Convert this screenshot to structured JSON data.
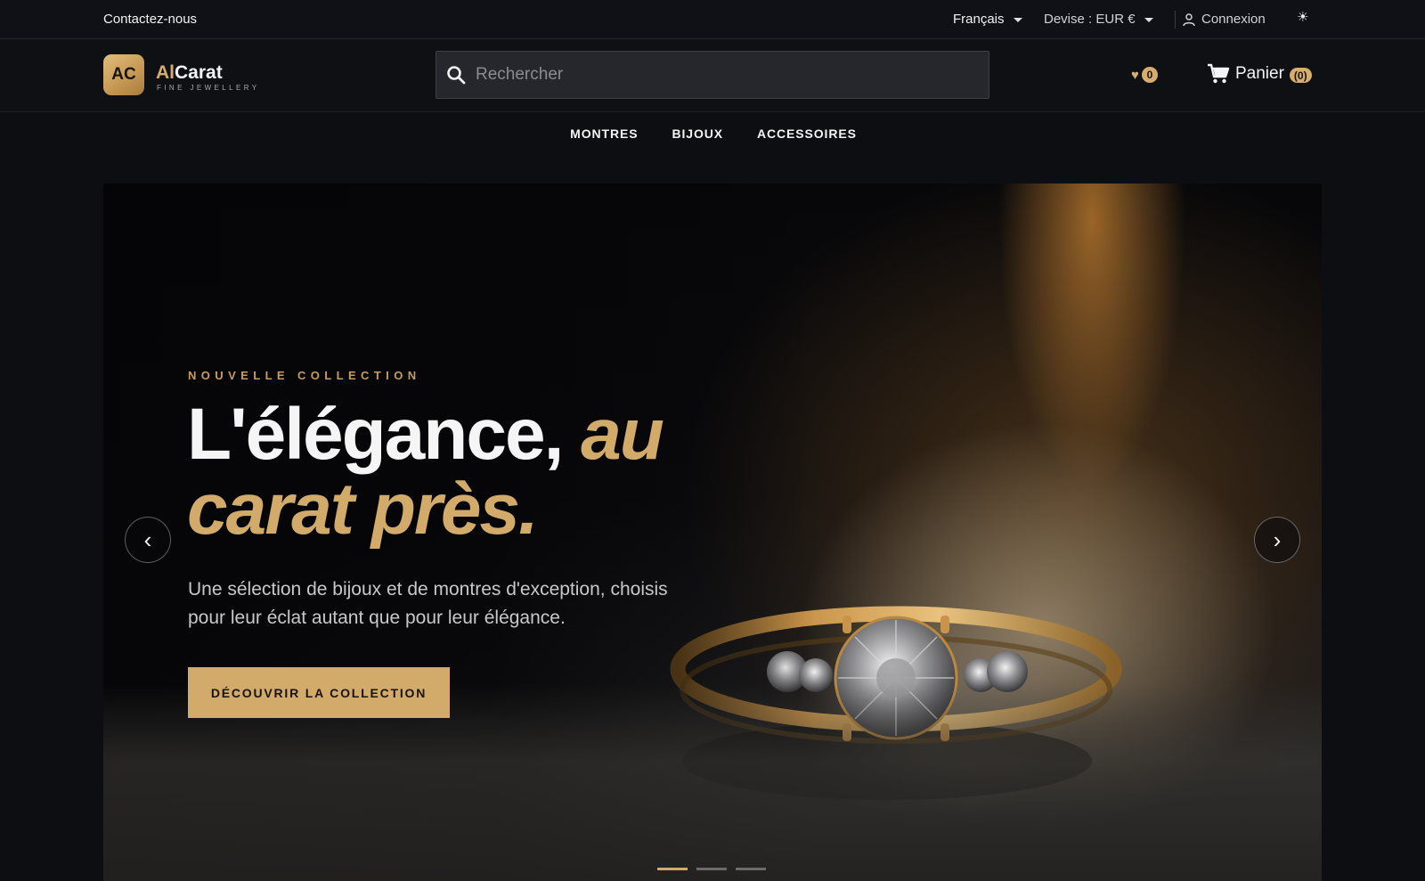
{
  "topbar": {
    "contact": "Contactez-nous",
    "language": "Français",
    "currency": "Devise : EUR €",
    "login": "Connexion",
    "theme_icon": "sun-icon"
  },
  "header": {
    "logo_initials": "AC",
    "brand_ai": "Al",
    "brand_rest": "Carat",
    "tagline": "FINE JEWELLERY",
    "search_placeholder": "Rechercher",
    "wishlist_count": "0",
    "cart_label": "Panier",
    "cart_count": "(0)"
  },
  "nav": {
    "items": [
      {
        "label": "MONTRES"
      },
      {
        "label": "BIJOUX"
      },
      {
        "label": "ACCESSOIRES"
      }
    ]
  },
  "hero": {
    "eyebrow": "NOUVELLE COLLECTION",
    "headline_white": "L'élégance,",
    "headline_gold": "au carat près.",
    "subtitle": "Une sélection de bijoux et de montres d'exception, choisis pour leur éclat autant que pour leur élégance.",
    "cta": "DÉCOUVRIR LA COLLECTION",
    "prev_symbol": "‹",
    "next_symbol": "›",
    "slides": 3,
    "active_slide": 1
  },
  "colors": {
    "accent_gold": "#d2aa69",
    "background": "#0d0e12"
  }
}
